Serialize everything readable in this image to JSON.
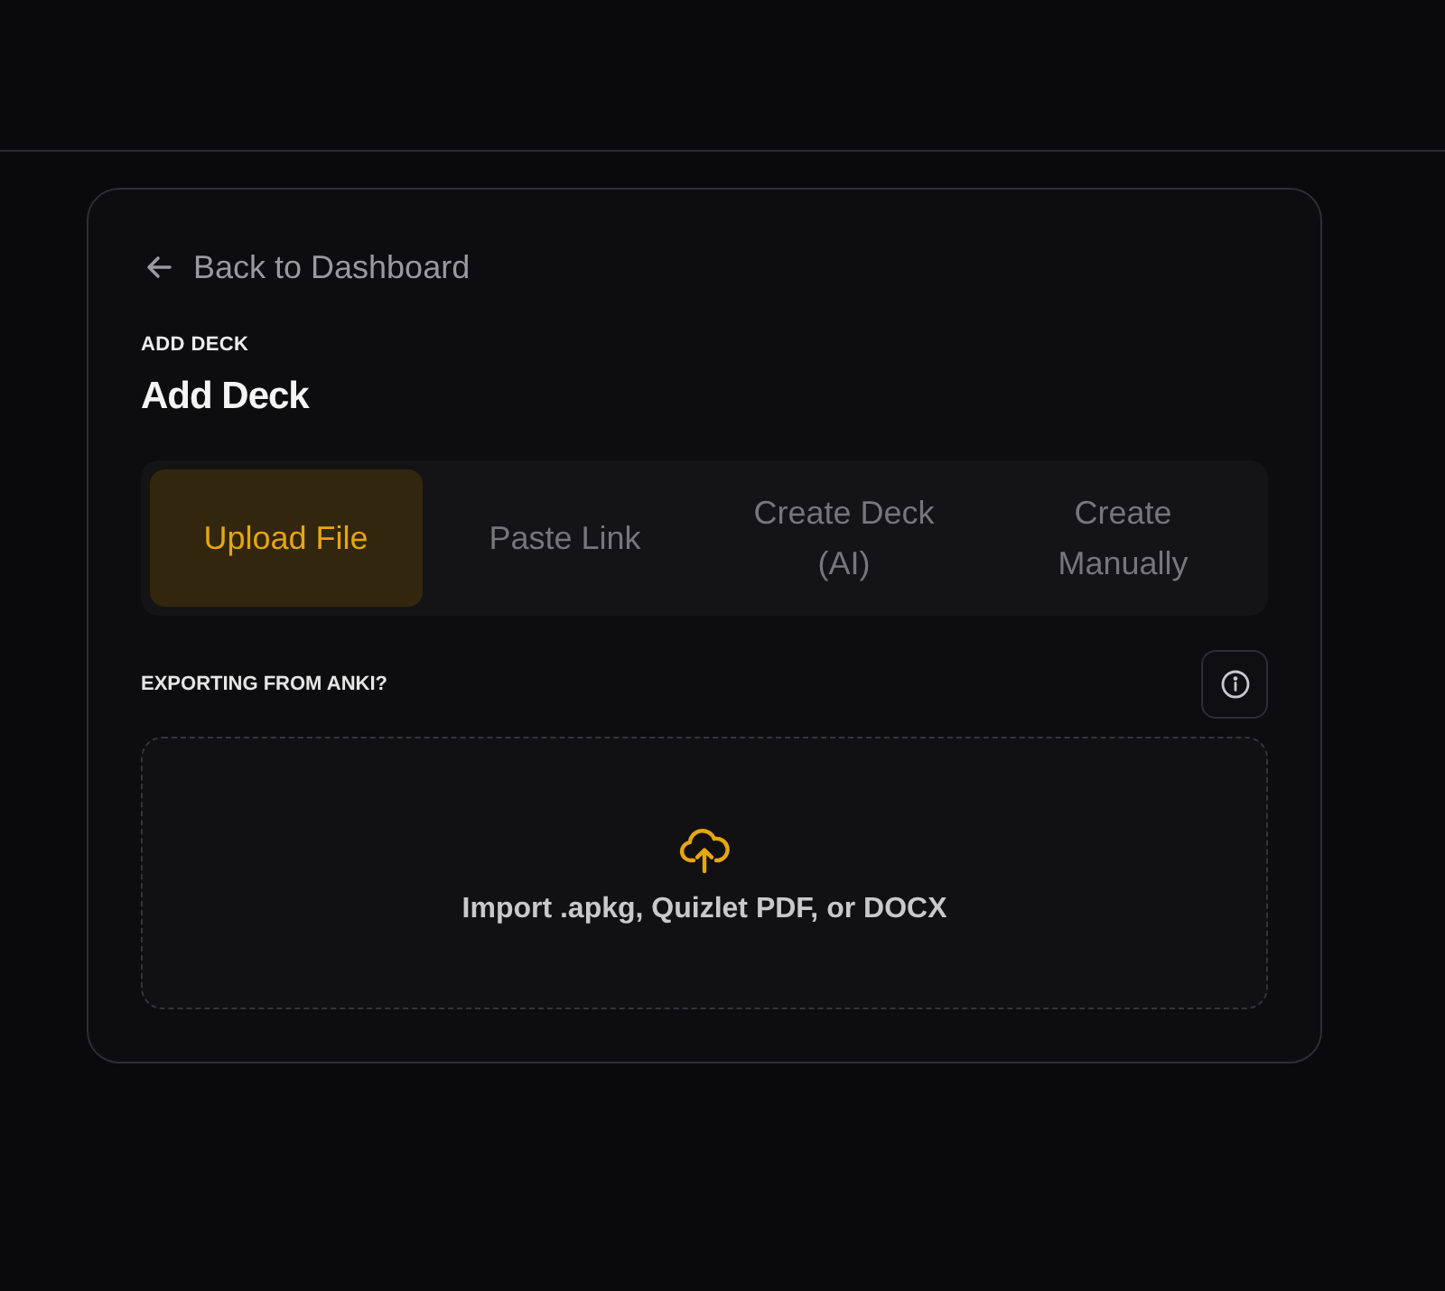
{
  "back_link": {
    "label": "Back to Dashboard"
  },
  "eyebrow": "ADD DECK",
  "title": "Add Deck",
  "tabs": [
    {
      "label": "Upload File",
      "selected": true
    },
    {
      "label": "Paste Link",
      "selected": false
    },
    {
      "label": "Create Deck (AI)",
      "selected": false
    },
    {
      "label": "Create Manually",
      "selected": false
    }
  ],
  "section_label": "EXPORTING FROM ANKI?",
  "dropzone": {
    "text": "Import .apkg, Quizlet PDF, or DOCX"
  }
}
